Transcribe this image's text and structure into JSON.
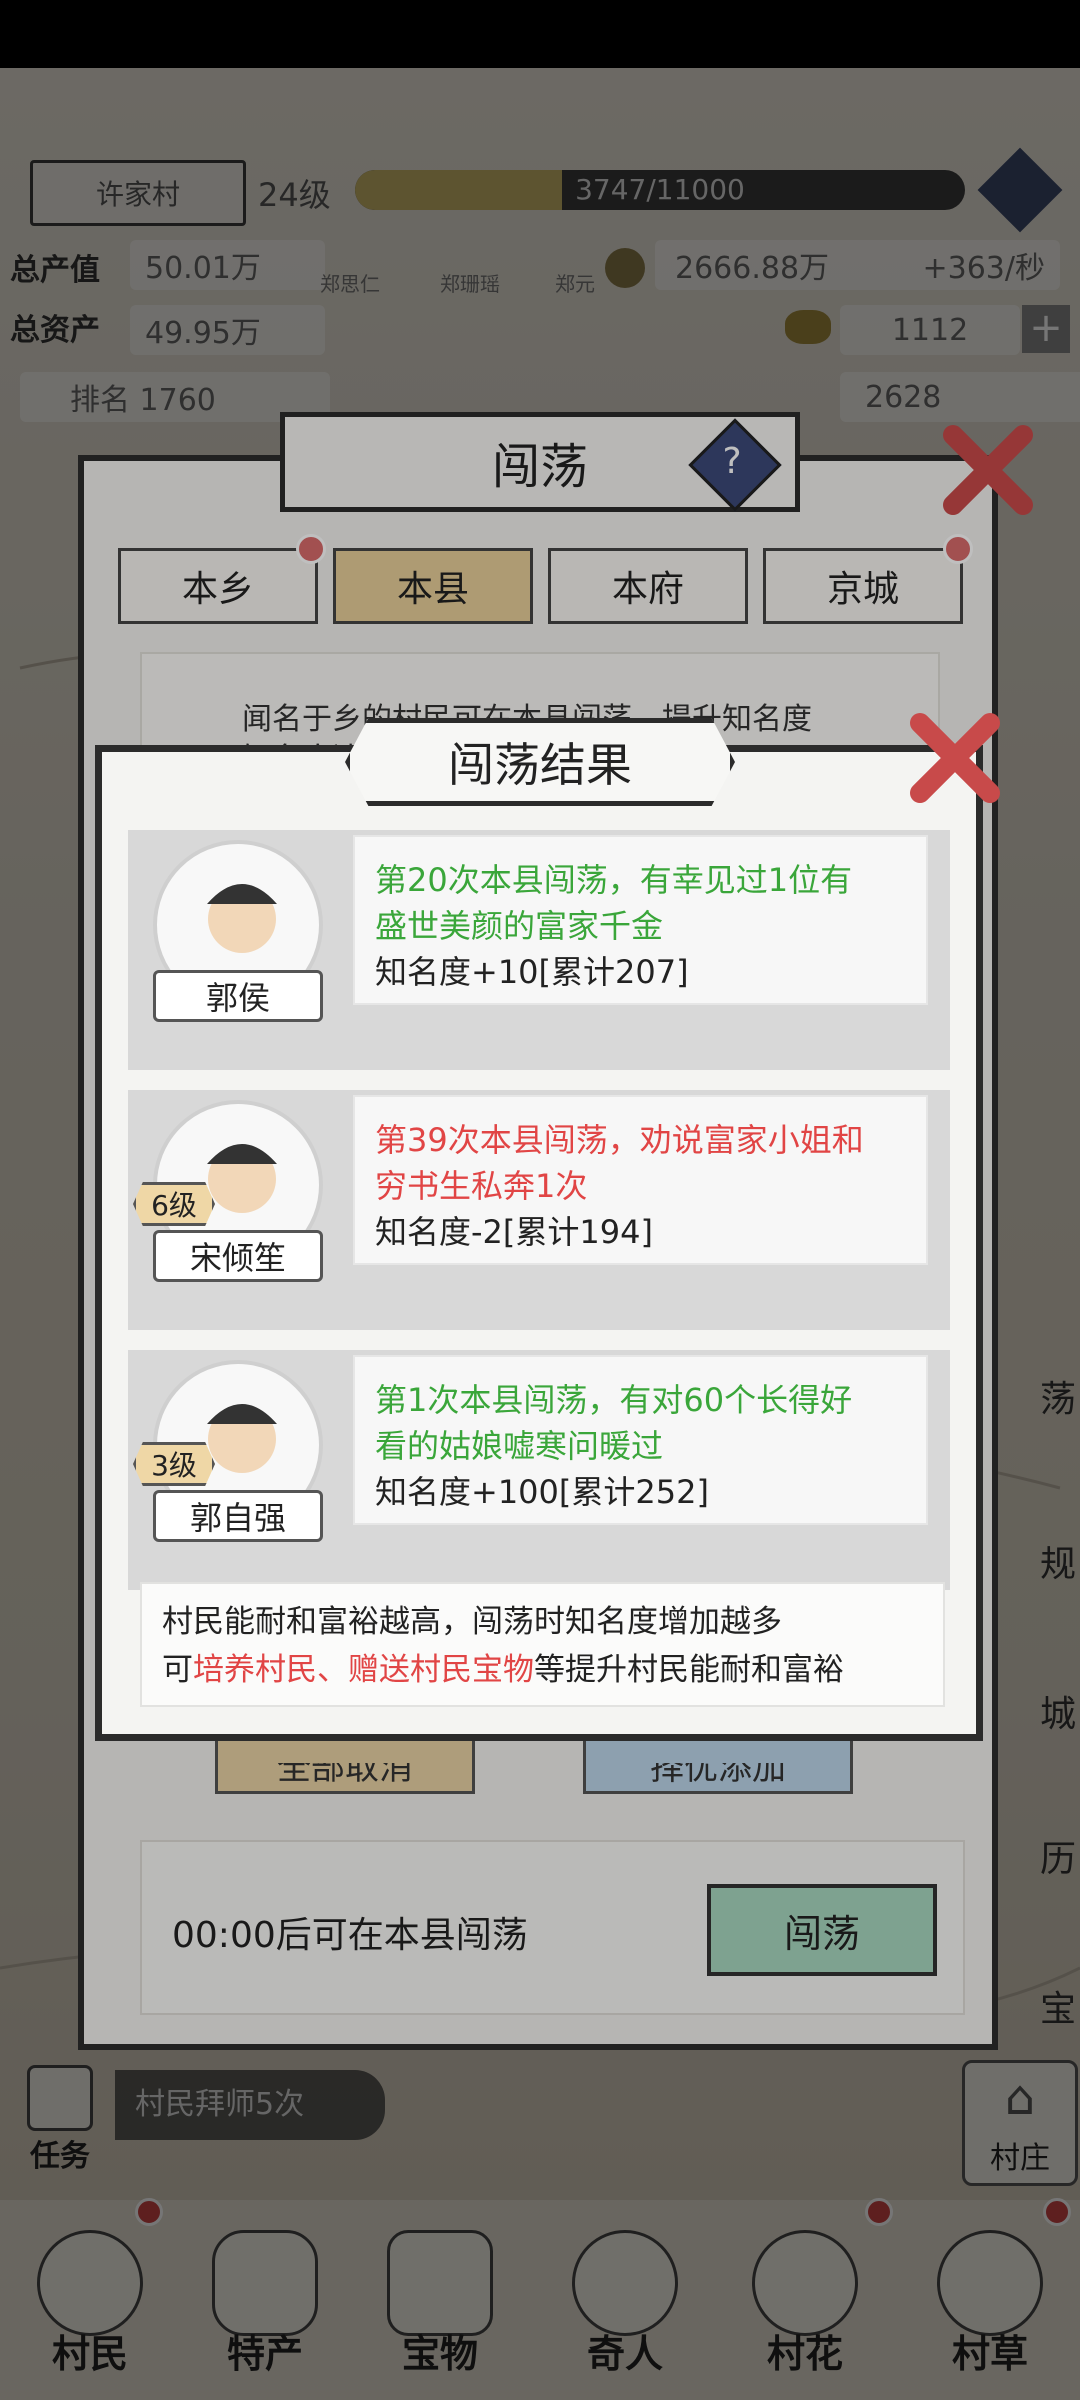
{
  "top": {
    "village_name": "许家村",
    "level": "24级",
    "exp": "3747/11000",
    "stat1_label": "总产值",
    "stat1_value": "50.01万",
    "stat2_label": "总资产",
    "stat2_value": "49.95万",
    "rank": "排名 1760",
    "money": "2666.88万",
    "money_rate": "+363/秒",
    "gold": "1112",
    "other": "2628",
    "names": [
      "郑思仁",
      "郑珊瑶",
      "郑元"
    ],
    "help": "?"
  },
  "dialog": {
    "title": "闯荡",
    "tabs": [
      {
        "label": "本乡"
      },
      {
        "label": "本县"
      },
      {
        "label": "本府"
      },
      {
        "label": "京城"
      }
    ],
    "desc_line1": "闻名于乡的村民可在本县闯荡，提升知名度",
    "desc_line2": "知名度达…",
    "btn_cancel_all": "全部取消",
    "btn_auto_add": "择优添加",
    "countdown": "00:00后可在本县闯荡",
    "go_button": "闯荡"
  },
  "result": {
    "title": "闯荡结果",
    "entries": [
      {
        "name": "郭侯",
        "level": "",
        "line1": "第20次本县闯荡，有幸见过1位有",
        "line2": "盛世美颜的富家千金",
        "line3": "知名度+10[累计207]",
        "tone": "green"
      },
      {
        "name": "宋倾笙",
        "level": "6级",
        "line1": "第39次本县闯荡，劝说富家小姐和",
        "line2": "穷书生私奔1次",
        "line3": "知名度-2[累计194]",
        "tone": "red"
      },
      {
        "name": "郭自强",
        "level": "3级",
        "line1": "第1次本县闯荡，有对60个长得好",
        "line2": "看的姑娘嘘寒问暖过",
        "line3": "知名度+100[累计252]",
        "tone": "green"
      }
    ],
    "tip_line1": "村民能耐和富裕越高，闯荡时知名度增加越多",
    "tip_prefix": "可",
    "tip_highlight": "培养村民、赠送村民宝物",
    "tip_suffix": "等提升村民能耐和富裕"
  },
  "task": {
    "label": "任务",
    "text": "村民拜师5次"
  },
  "side_right": [
    "荡",
    "规",
    "城",
    "历",
    "宝"
  ],
  "village_btn": "村庄",
  "bottom_tabs": [
    {
      "label": "村民"
    },
    {
      "label": "特产"
    },
    {
      "label": "宝物"
    },
    {
      "label": "奇人"
    },
    {
      "label": "村花"
    },
    {
      "label": "村草"
    }
  ],
  "colors": {
    "accent_gold": "#e8cf9a",
    "good_green": "#3aa63a",
    "bad_red": "#e14545",
    "go_green": "#a8d8c0"
  }
}
